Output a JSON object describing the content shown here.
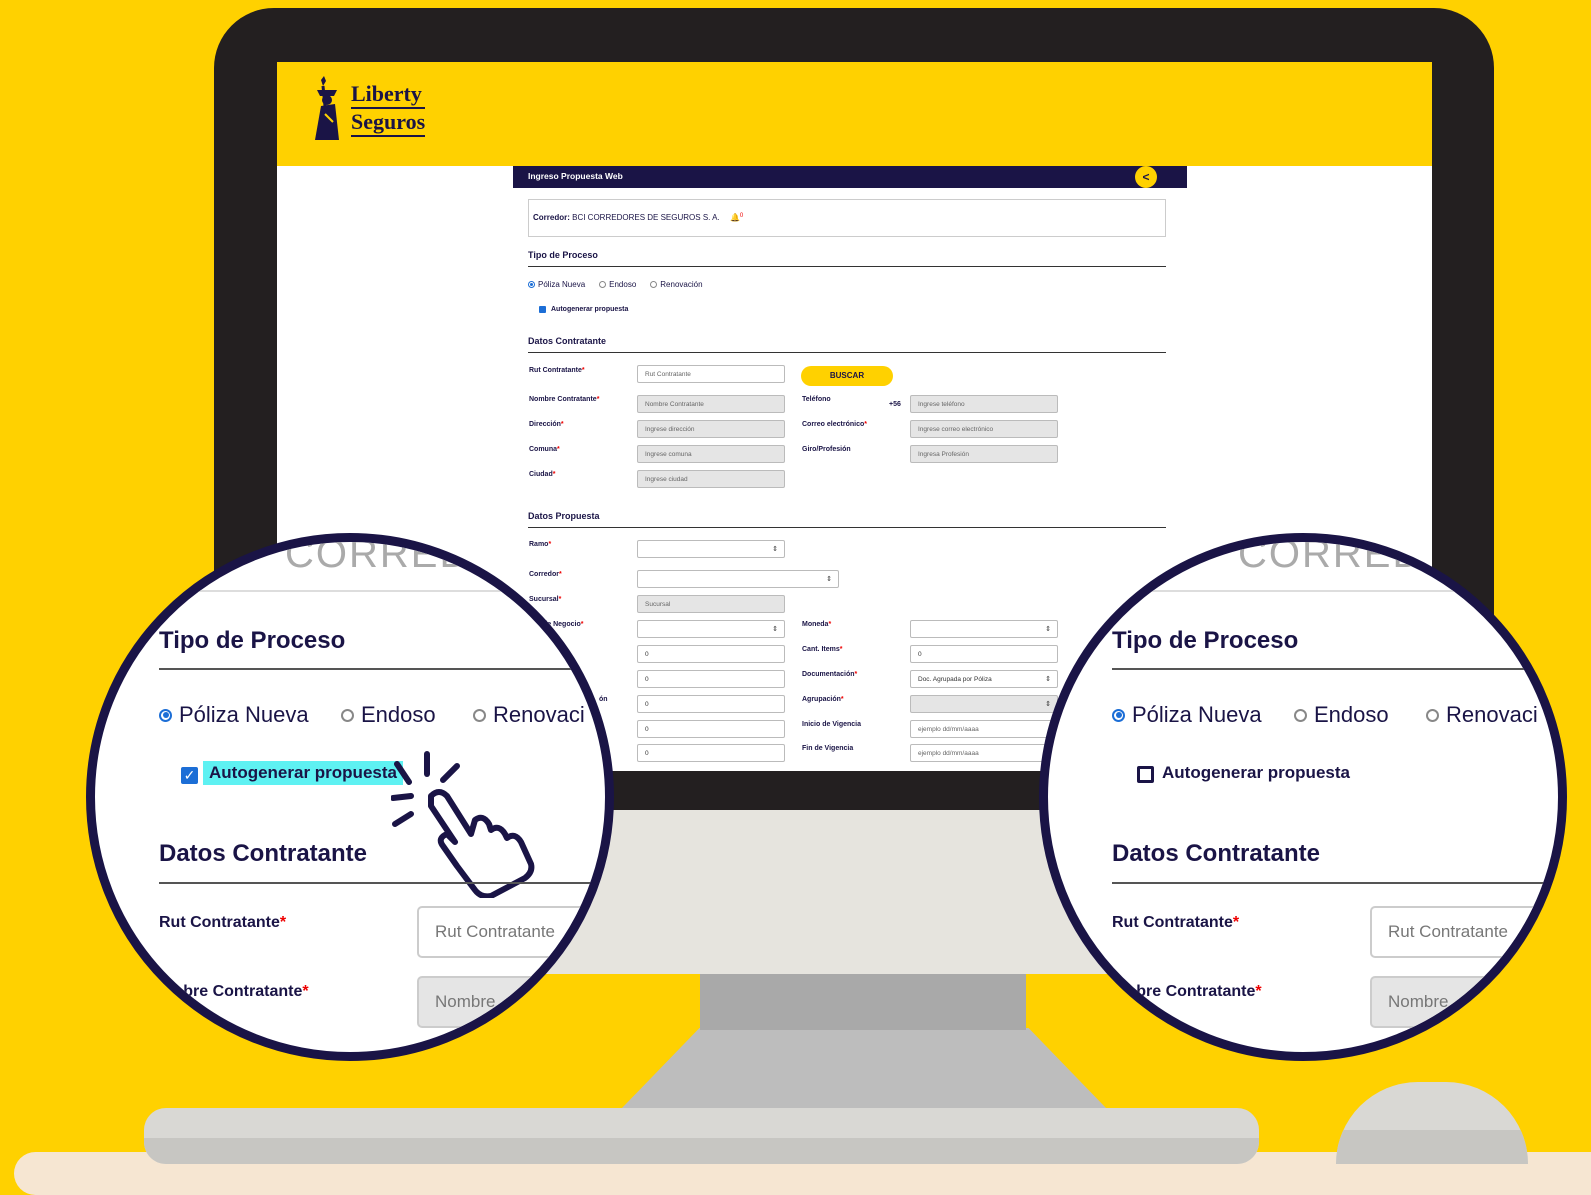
{
  "app": {
    "brand_line1": "Liberty",
    "brand_line2": "Seguros",
    "colors": {
      "brand_yellow": "#FFD100",
      "brand_navy": "#1A1446",
      "accent_blue": "#1c6ed6",
      "required_red": "#e00000",
      "highlight_cyan": "#5EF1F2"
    }
  },
  "form": {
    "header_title": "Ingreso Propuesta Web",
    "collapse_icon": "<",
    "corredor_label": "Corredor:",
    "corredor_value": "BCI CORREDORES DE SEGUROS S. A.",
    "notifications_count": "0",
    "tipo_proceso": {
      "title": "Tipo de Proceso",
      "options": [
        "Póliza Nueva",
        "Endoso",
        "Renovación"
      ],
      "selected": "Póliza Nueva",
      "autogenerar_label": "Autogenerar propuesta",
      "autogenerar_checked": true
    },
    "datos_contratante": {
      "title": "Datos Contratante",
      "rut_label": "Rut Contratante",
      "rut_placeholder": "Rut Contratante",
      "buscar_label": "BUSCAR",
      "nombre_label": "Nombre Contratante",
      "nombre_placeholder": "Nombre Contratante",
      "telefono_label": "Teléfono",
      "telefono_prefix": "+56",
      "telefono_placeholder": "Ingrese teléfono",
      "direccion_label": "Dirección",
      "direccion_placeholder": "Ingrese dirección",
      "correo_label": "Correo electrónico",
      "correo_placeholder": "Ingrese correo electrónico",
      "comuna_label": "Comuna",
      "comuna_placeholder": "Ingrese comuna",
      "giro_label": "Giro/Profesión",
      "giro_placeholder": "Ingresa Profesión",
      "ciudad_label": "Ciudad",
      "ciudad_placeholder": "Ingrese ciudad"
    },
    "datos_propuesta": {
      "title": "Datos Propuesta",
      "ramo_label": "Ramo",
      "corredor_label": "Corredor",
      "sucursal_label": "Sucursal",
      "sucursal_placeholder": "Sucursal",
      "negocio_label": "de Negocio",
      "moneda_label": "Moneda",
      "cant_items_label": "Cant. Items",
      "cant_items_value": "0",
      "documentacion_label": "Documentación",
      "documentacion_value": "Doc. Agrupada por Póliza",
      "agrupacion_label": "Agrupación",
      "inicio_label": "Inicio de Vigencia",
      "inicio_placeholder": "ejemplo dd/mm/aaaa",
      "fin_label": "Fin de Vigencia",
      "fin_placeholder": "ejemplo dd/mm/aaaa",
      "left_values": [
        "0",
        "0",
        "0",
        "0",
        "0"
      ],
      "partial_label_on": "ón"
    }
  },
  "zoom_left": {
    "top_partial": "CORREDOR",
    "title": "Tipo de Proceso",
    "options": [
      "Póliza Nueva",
      "Endoso",
      "Renovaci"
    ],
    "checkbox_label": "Autogenerar propuesta",
    "checked": true,
    "section": "Datos Contratante",
    "rut_label": "Rut Contratante",
    "rut_placeholder": "Rut Contratante",
    "nombre_label": "mbre Contratante",
    "nombre_placeholder": "Nombre"
  },
  "zoom_right": {
    "top_partial": "CORREDO",
    "title": "Tipo de Proceso",
    "options": [
      "Póliza Nueva",
      "Endoso",
      "Renovaci"
    ],
    "checkbox_label": "Autogenerar propuesta",
    "checked": false,
    "section": "Datos Contratante",
    "rut_label": "Rut Contratante",
    "rut_placeholder": "Rut Contratante",
    "nombre_label": "mbre Contratante",
    "nombre_placeholder": "Nombre"
  }
}
